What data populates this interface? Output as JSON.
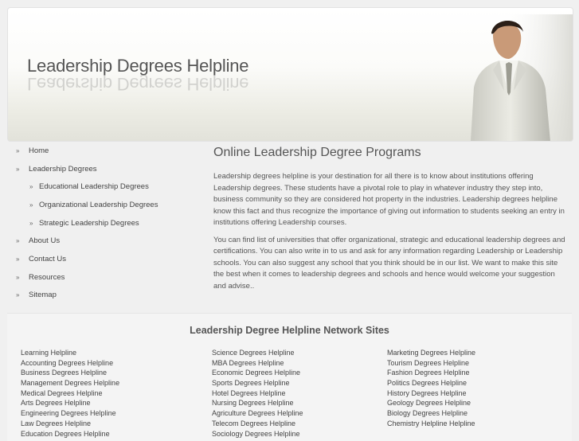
{
  "header": {
    "title": "Leadership Degrees Helpline"
  },
  "nav": {
    "items": [
      {
        "label": "Home"
      },
      {
        "label": "Leadership Degrees"
      },
      {
        "label": "Educational Leadership Degrees",
        "sub": true
      },
      {
        "label": "Organizational Leadership Degrees",
        "sub": true
      },
      {
        "label": "Strategic Leadership Degrees",
        "sub": true
      },
      {
        "label": "About Us"
      },
      {
        "label": "Contact Us"
      },
      {
        "label": "Resources"
      },
      {
        "label": "Sitemap"
      }
    ],
    "bullet": "»"
  },
  "main": {
    "heading": "Online Leadership Degree Programs",
    "paragraphs": [
      "Leadership degrees helpline is your destination for all there is to know about institutions offering Leadership degrees. These students have a pivotal role to play in whatever industry they step into, business community so they are considered hot property in the industries. Leadership degrees helpline know this fact and thus recognize the importance of giving out information to students seeking an entry in institutions offering Leadership courses.",
      "You can find list of universities that offer organizational, strategic and educational leadership degrees and certifications. You can also write in to us and ask for any information regarding Leadership or Leadership schools. You can also suggest any school that you think should be in our list. We want to make this site the best when it comes to leadership degrees and schools and hence would welcome your suggestion and advise.."
    ]
  },
  "network": {
    "heading": "Leadership Degree Helpline Network Sites",
    "columns": [
      [
        "Learning Helpline",
        "Accounting Degrees Helpline",
        "Business Degrees Helpline",
        "Management Degrees Helpline",
        "Medical Degrees Helpline",
        "Arts Degrees Helpline",
        "Engineering Degrees Helpline",
        "Law Degrees Helpline",
        "Education Degrees Helpline"
      ],
      [
        "Science Degrees Helpline",
        "MBA Degrees Helpline",
        "Economic Degrees Helpline",
        "Sports Degrees Helpline",
        "Hotel Degrees Helpline",
        "Nursing Degrees Helpline",
        "Agriculture Degrees Helpline",
        "Telecom Degrees Helpline",
        "Sociology Degrees Helpline"
      ],
      [
        "Marketing Degrees Helpline",
        "Tourism Degrees Helpline",
        "Fashion Degrees Helpline",
        "Politics Degrees Helpline",
        "History Degrees Helpline",
        "Geology Degrees Helpline",
        "Biology Degrees Helpline",
        "Chemistry Helpline Helpline"
      ]
    ]
  }
}
